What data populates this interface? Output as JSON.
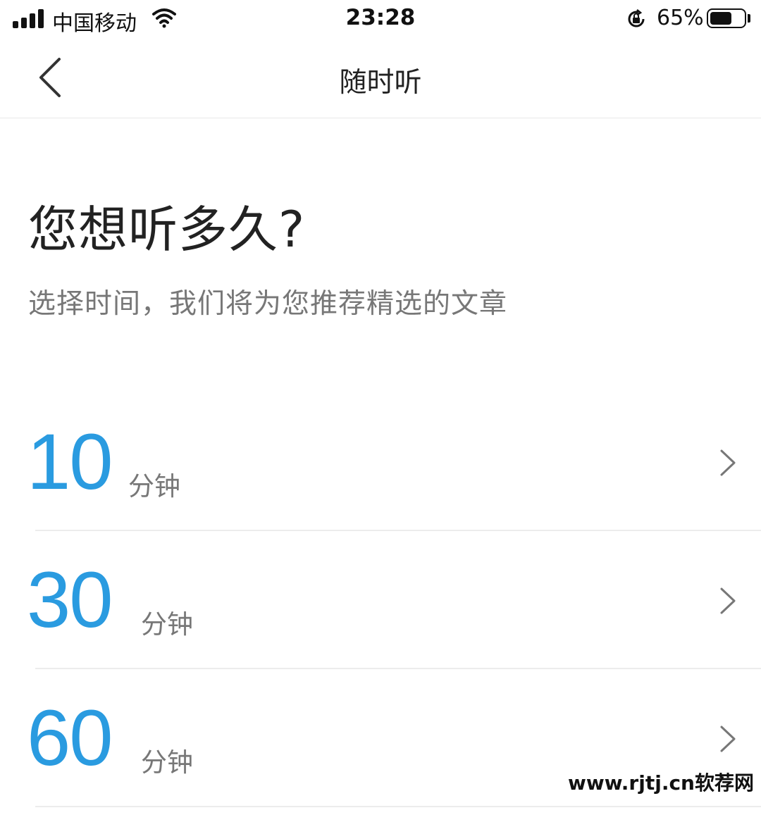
{
  "status_bar": {
    "carrier": "中国移动",
    "time": "23:28",
    "battery_percent_text": "65%",
    "battery_level": 0.65,
    "icons": [
      "signal-icon",
      "wifi-icon",
      "rotation-lock-icon",
      "battery-icon"
    ]
  },
  "nav": {
    "title": "随时听",
    "back_icon": "chevron-left-icon"
  },
  "main": {
    "heading": "您想听多久?",
    "subtitle": "选择时间，我们将为您推荐精选的文章",
    "options": [
      {
        "number": "10",
        "unit": "分钟"
      },
      {
        "number": "30",
        "unit": "分钟"
      },
      {
        "number": "60",
        "unit": "分钟"
      }
    ]
  },
  "watermark": "www.rjtj.cn软荐网",
  "colors": {
    "accent": "#2a9be0",
    "text_primary": "#222222",
    "text_secondary": "#777777",
    "divider": "#ececec"
  }
}
